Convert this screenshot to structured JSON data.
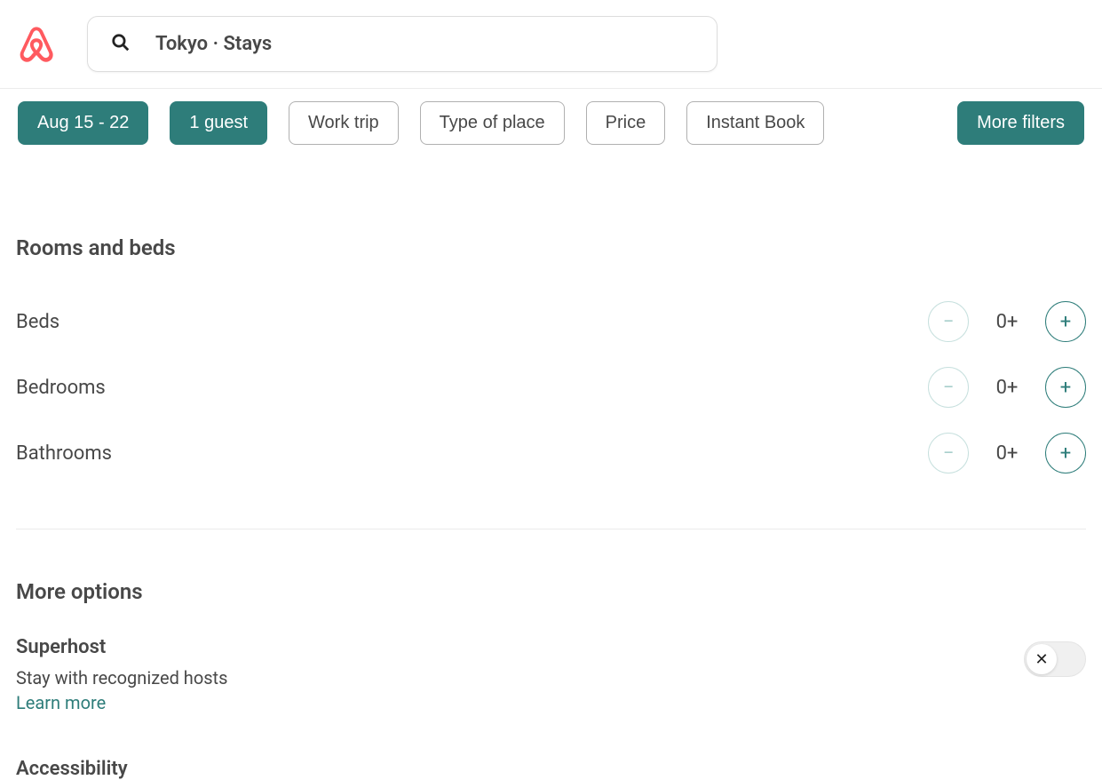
{
  "header": {
    "search_text": "Tokyo · Stays"
  },
  "filters": {
    "dates": "Aug 15 - 22",
    "guests": "1 guest",
    "work_trip": "Work trip",
    "type_of_place": "Type of place",
    "price": "Price",
    "instant_book": "Instant Book",
    "more_filters": "More filters"
  },
  "rooms_section": {
    "title": "Rooms and beds",
    "items": [
      {
        "label": "Beds",
        "value": "0+"
      },
      {
        "label": "Bedrooms",
        "value": "0+"
      },
      {
        "label": "Bathrooms",
        "value": "0+"
      }
    ]
  },
  "more_options": {
    "title": "More options",
    "superhost": {
      "title": "Superhost",
      "desc": "Stay with recognized hosts",
      "learn_more": "Learn more"
    },
    "accessibility": {
      "title": "Accessibility"
    }
  },
  "glyphs": {
    "minus": "−",
    "plus": "+",
    "x": "✕"
  }
}
